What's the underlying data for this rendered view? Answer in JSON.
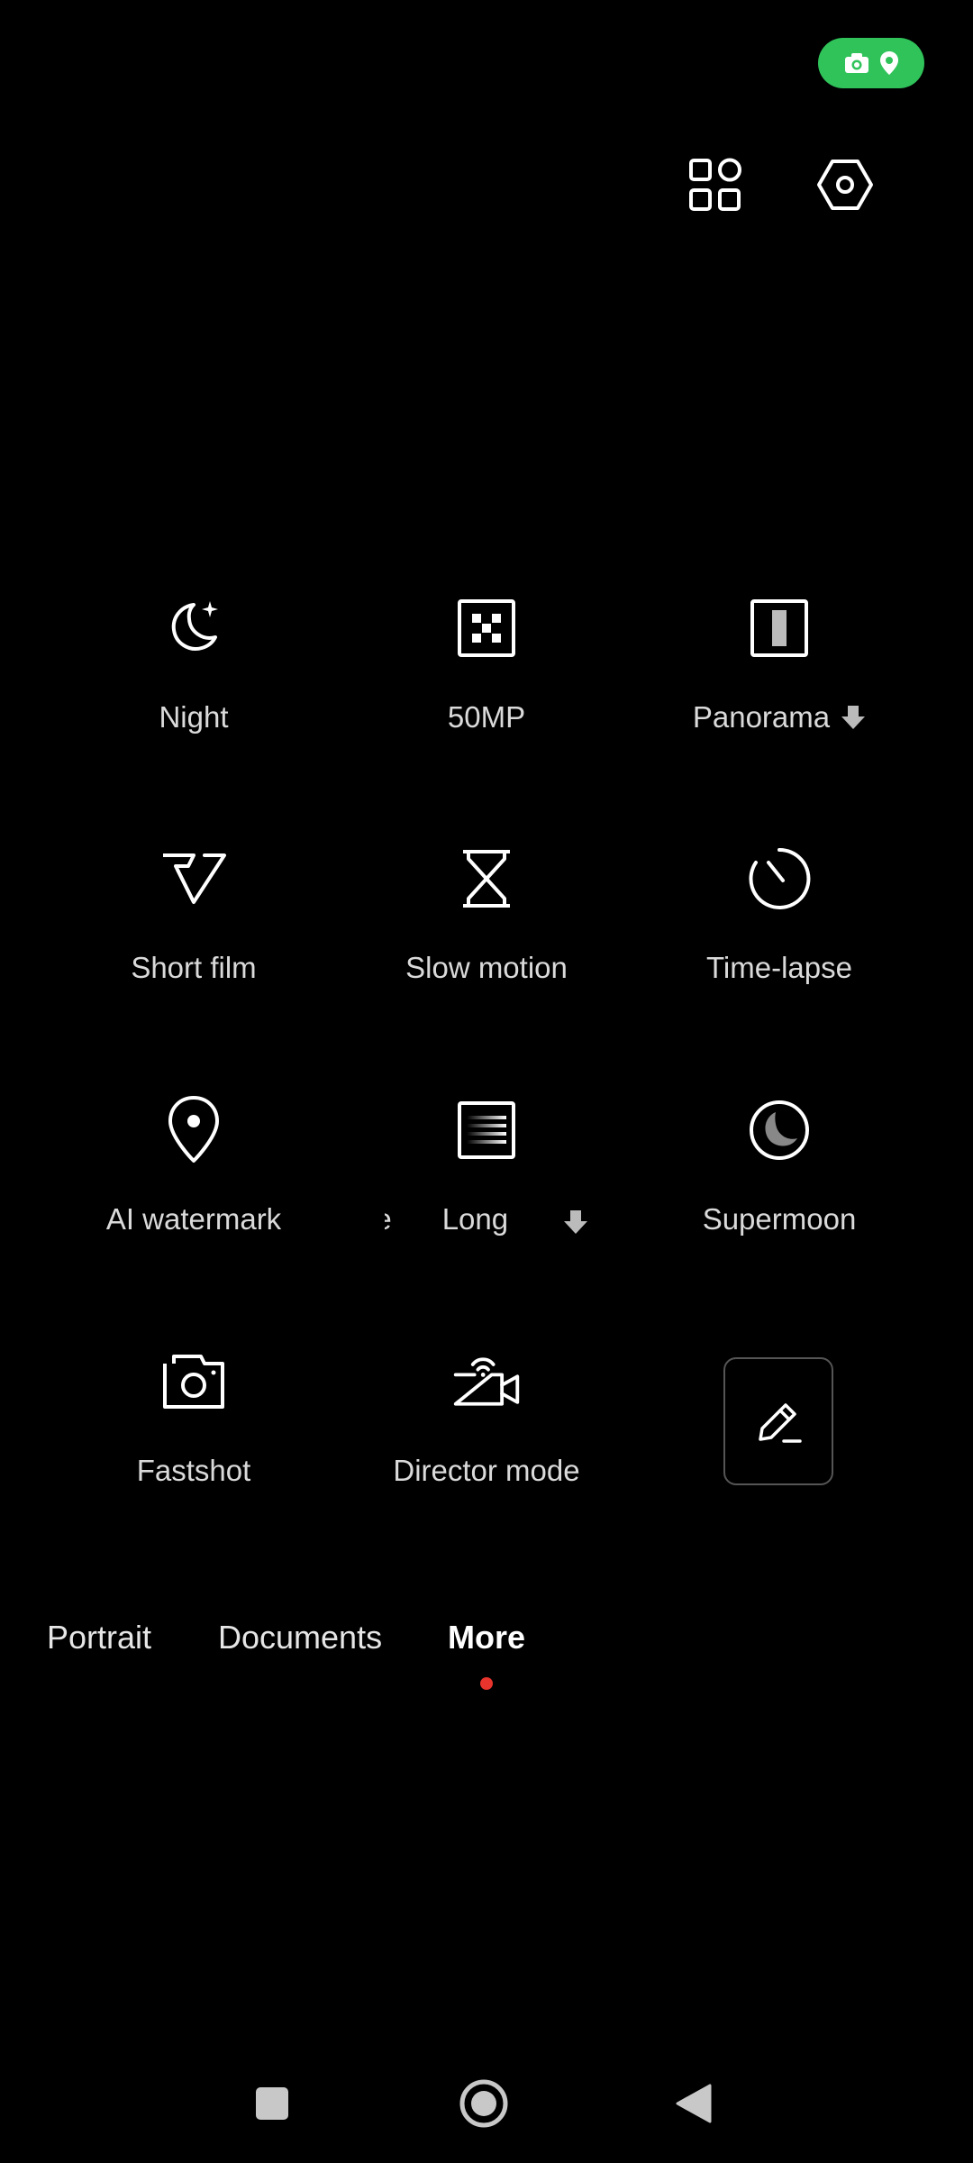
{
  "status": {
    "privacy_indicator_color": "#2fc35a",
    "privacy_icons": [
      "camera-icon",
      "location-icon"
    ]
  },
  "top_actions": {
    "grid_icon": "layout-grid-icon",
    "settings_icon": "settings-hexagon-icon"
  },
  "modes": [
    {
      "label": "Night",
      "icon": "moon-sparkle-icon",
      "download": false
    },
    {
      "label": "50MP",
      "icon": "high-res-grid-icon",
      "download": false
    },
    {
      "label": "Panorama",
      "icon": "panorama-icon",
      "download": true
    },
    {
      "label": "Short film",
      "icon": "short-film-icon",
      "download": false
    },
    {
      "label": "Slow motion",
      "icon": "hourglass-icon",
      "download": false
    },
    {
      "label": "Time-lapse",
      "icon": "timer-dial-icon",
      "download": false
    },
    {
      "label": "AI watermark",
      "icon": "location-pin-icon",
      "download": false
    },
    {
      "label": "Long exposure",
      "visible_text_a": "ure",
      "visible_text_b": "Long",
      "icon": "long-exposure-icon",
      "download": true
    },
    {
      "label": "Supermoon",
      "icon": "supermoon-icon",
      "download": false
    },
    {
      "label": "Fastshot",
      "icon": "fastshot-camera-icon",
      "download": false
    },
    {
      "label": "Director mode",
      "icon": "director-camera-icon",
      "download": false
    }
  ],
  "edit_button": {
    "icon": "pencil-edit-icon"
  },
  "mode_tabs": [
    {
      "label": "Portrait",
      "active": false
    },
    {
      "label": "Documents",
      "active": false
    },
    {
      "label": "More",
      "active": true
    }
  ],
  "active_indicator_color": "#e8342c",
  "nav": {
    "recents_icon": "square-icon",
    "home_icon": "home-circle-icon",
    "back_icon": "back-triangle-icon"
  }
}
